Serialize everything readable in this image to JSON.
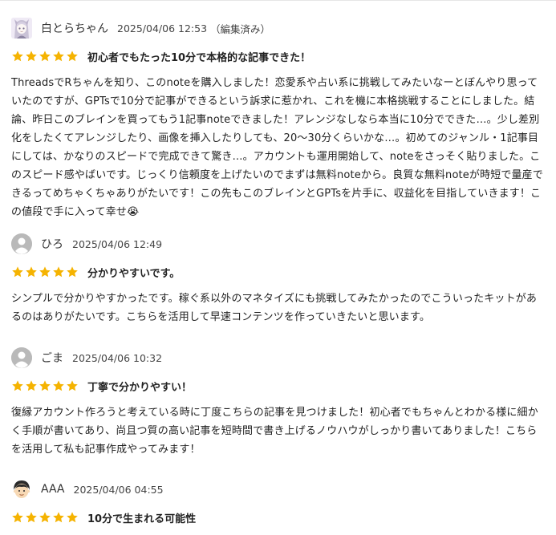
{
  "colors": {
    "star": "#f5b301",
    "text": "#222222",
    "meta": "#444444",
    "avatar_gray": "#b9b9b9"
  },
  "reviews": [
    {
      "avatar_icon": "anime-character-avatar-icon",
      "name": "白とらちゃん",
      "date": "2025/04/06 12:53",
      "edited": "（編集済み）",
      "rating": 5,
      "title": "初心者でもたった10分で本格的な記事できた！",
      "body": "ThreadsでRちゃんを知り、このnoteを購入しました！恋愛系や占い系に挑戦してみたいなーとぼんやり思っていたのですが、GPTsで10分で記事ができるという訴求に惹かれ、これを機に本格挑戦することにしました。結論、昨日このブレインを買ってもう1記事noteできました！アレンジなしなら本当に10分でできた…。少し差別化をしたくてアレンジしたり、画像を挿入したりしても、20〜30分くらいかな…。初めてのジャンル・1記事目にしては、かなりのスピードで完成できて驚き…。アカウントも運用開始して、noteをさっそく貼りました。このスピード感やばいです。じっくり信頼度を上げたいのでまずは無料noteから。良質な無料noteが時短で量産できるってめちゃくちゃありがたいです！この先もこのブレインとGPTsを片手に、収益化を目指していきます！この値段で手に入って幸せ😭"
    },
    {
      "avatar_icon": "default-user-icon",
      "name": "ひろ",
      "date": "2025/04/06 12:49",
      "edited": "",
      "rating": 5,
      "title": "分かりやすいです。",
      "body": "シンプルで分かりやすかったです。稼ぐ系以外のマネタイズにも挑戦してみたかったのでこういったキットがあるのはありがたいです。こちらを活用して早速コンテンツを作っていきたいと思います。"
    },
    {
      "avatar_icon": "default-user-icon",
      "name": "ごま",
      "date": "2025/04/06 10:32",
      "edited": "",
      "rating": 5,
      "title": "丁寧で分かりやすい！",
      "body": "復縁アカウント作ろうと考えている時に丁度こちらの記事を見つけました！初心者でもちゃんとわかる様に細かく手順が書いてあり、尚且つ質の高い記事を短時間で書き上げるノウハウがしっかり書いてありました！こちらを活用して私も記事作成やってみます！"
    },
    {
      "avatar_icon": "cartoon-face-avatar-icon",
      "name": "AAA",
      "date": "2025/04/06 04:55",
      "edited": "",
      "rating": 5,
      "title": "10分で生まれる可能性",
      "body": ""
    }
  ]
}
